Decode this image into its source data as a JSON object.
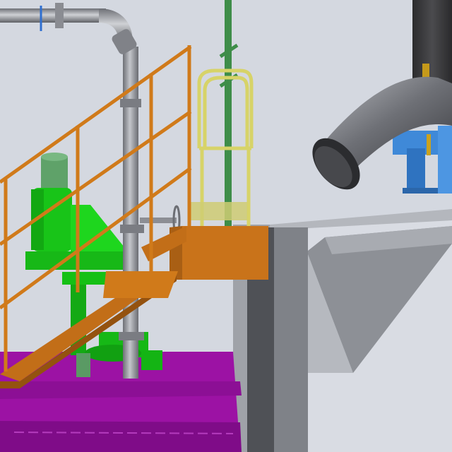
{
  "scene": {
    "kind": "3d-plant-model-view",
    "objects": [
      {
        "name": "process-pipe",
        "color": "#9a9ca2"
      },
      {
        "name": "pipe-elbow",
        "color": "#7c7f86"
      },
      {
        "name": "green-pump-motor",
        "color": "#18c418"
      },
      {
        "name": "orange-stair-handrail",
        "color": "#d07a1a"
      },
      {
        "name": "orange-platform",
        "color": "#c9731a"
      },
      {
        "name": "yellow-safety-cage",
        "color": "#d8d46a"
      },
      {
        "name": "green-vertical-ladder-pipe",
        "color": "#3f8f4a"
      },
      {
        "name": "purple-base-slab",
        "color": "#9a0fa0"
      },
      {
        "name": "grey-concrete-wall",
        "color": "#9b9ea5"
      },
      {
        "name": "blue-steel-support",
        "color": "#3b86d4"
      },
      {
        "name": "dark-vertical-stack",
        "color": "#3a3a3c"
      },
      {
        "name": "hand-wheel-valve",
        "color": "#8a8c92"
      }
    ]
  }
}
